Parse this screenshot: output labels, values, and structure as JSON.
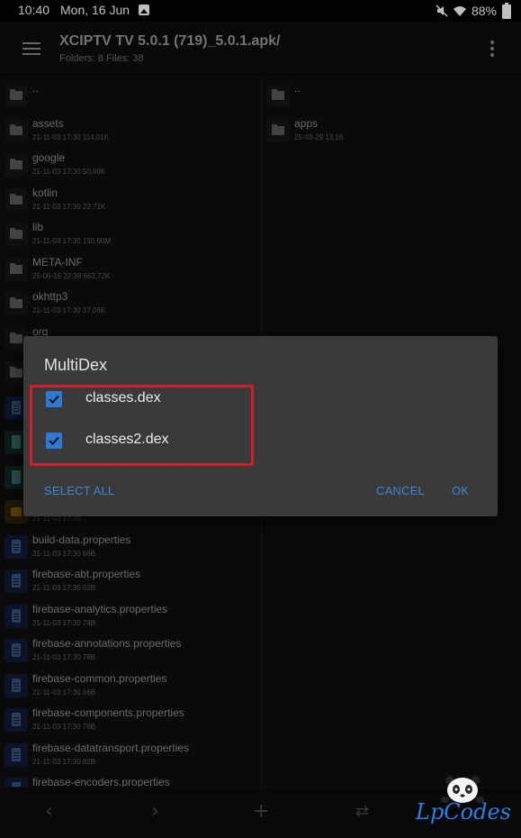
{
  "status_bar": {
    "time": "10:40",
    "date": "Mon, 16 Jun",
    "battery": "88%"
  },
  "toolbar": {
    "title": "XCIPTV TV 5.0.1 (719)_5.0.1.apk/",
    "subtitle": "Folders: 8 Files: 38"
  },
  "left_pane": {
    "items": [
      {
        "name": "..",
        "meta": "",
        "icon": "folder-icon"
      },
      {
        "name": "assets",
        "meta": "21-11-03 17:30  114,01K",
        "icon": "folder-icon"
      },
      {
        "name": "google",
        "meta": "21-11-03 17:30  50,69K",
        "icon": "folder-icon"
      },
      {
        "name": "kotlin",
        "meta": "21-11-03 17:30  22,71K",
        "icon": "folder-icon"
      },
      {
        "name": "lib",
        "meta": "21-11-03 17:30  150,60M",
        "icon": "folder-icon"
      },
      {
        "name": "META-INF",
        "meta": "25-06-16 22:38  663,72K",
        "icon": "folder-icon"
      },
      {
        "name": "okhttp3",
        "meta": "21-11-03 17:30  37,06K",
        "icon": "folder-icon"
      },
      {
        "name": "org",
        "meta": "",
        "icon": "folder-icon"
      },
      {
        "name": "",
        "meta": "",
        "icon": "folder-icon"
      },
      {
        "name": "",
        "meta": "",
        "icon": "file-doc-icon"
      },
      {
        "name": "",
        "meta": "",
        "icon": "file-teal-icon"
      },
      {
        "name": "",
        "meta": "",
        "icon": "file-teal-icon"
      },
      {
        "name": "",
        "meta": "21-11-03 17:30  ...",
        "icon": "file-amber-icon"
      },
      {
        "name": "build-data.properties",
        "meta": "21-11-03 17:30  66B",
        "icon": "file-doc-icon"
      },
      {
        "name": "firebase-abt.properties",
        "meta": "21-11-03 17:30  62B",
        "icon": "file-doc-icon"
      },
      {
        "name": "firebase-analytics.properties",
        "meta": "21-11-03 17:30  74B",
        "icon": "file-doc-icon"
      },
      {
        "name": "firebase-annotations.properties",
        "meta": "21-11-03 17:30  78B",
        "icon": "file-doc-icon"
      },
      {
        "name": "firebase-common.properties",
        "meta": "21-11-03 17:30  66B",
        "icon": "file-doc-icon"
      },
      {
        "name": "firebase-components.properties",
        "meta": "21-11-03 17:30  76B",
        "icon": "file-doc-icon"
      },
      {
        "name": "firebase-datatransport.properties",
        "meta": "21-11-03 17:30  82B",
        "icon": "file-doc-icon"
      },
      {
        "name": "firebase-encoders.properties",
        "meta": "",
        "icon": "file-doc-icon"
      }
    ]
  },
  "right_pane": {
    "items": [
      {
        "name": "..",
        "meta": "",
        "icon": "folder-icon"
      },
      {
        "name": "apps",
        "meta": "25-03-29 13:16",
        "icon": "folder-icon"
      }
    ]
  },
  "dialog": {
    "title": "MultiDex",
    "options": [
      {
        "label": "classes.dex",
        "checked": true
      },
      {
        "label": "classes2.dex",
        "checked": true
      }
    ],
    "select_all": "SELECT ALL",
    "cancel": "CANCEL",
    "ok": "OK"
  },
  "bottom_bar": {
    "back_icon": "chevron-left-icon",
    "forward_icon": "chevron-right-icon",
    "add_icon": "plus-icon",
    "swap_icon": "swap-icon"
  },
  "watermark": {
    "text": "LpCodes"
  },
  "colors": {
    "dialog_bg": "#3a3a3a",
    "accent": "#3e86d4",
    "checkbox": "#2e79d6",
    "highlight": "#d61e28"
  }
}
